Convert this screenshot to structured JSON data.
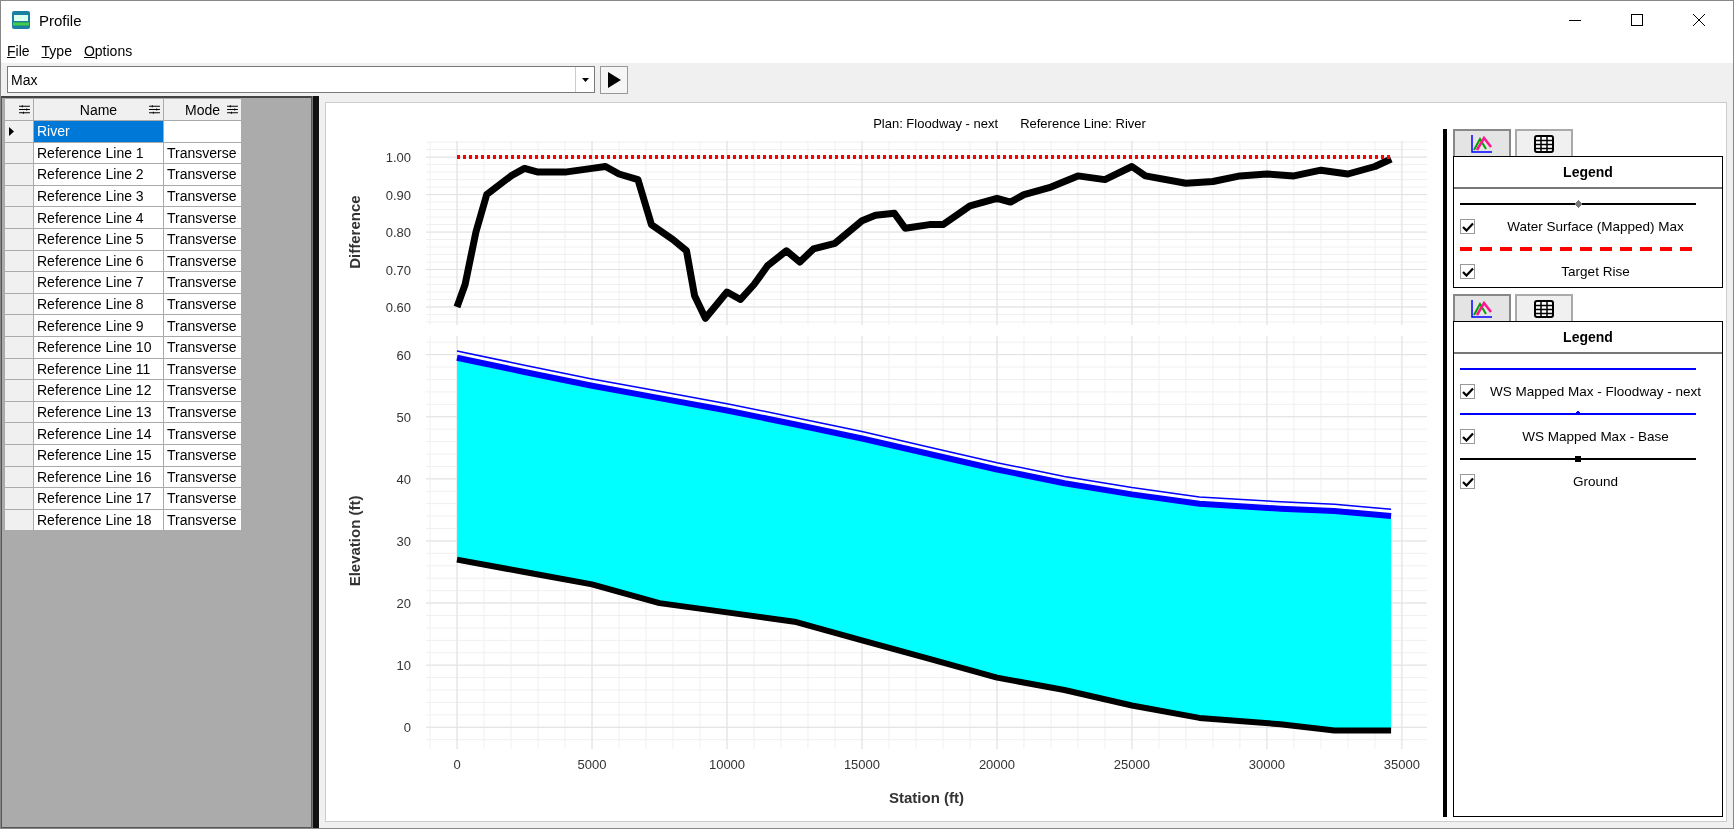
{
  "window": {
    "title": "Profile"
  },
  "menu": [
    "File",
    "Type",
    "Options"
  ],
  "profile_selector": {
    "value": "Max"
  },
  "table": {
    "columns": [
      "Name",
      "Mode"
    ],
    "rows": [
      {
        "name": "River",
        "selected": true
      },
      {
        "name": "Reference Line 1",
        "mode": "Transverse",
        "selected": false
      },
      {
        "name": "Reference Line 2",
        "mode": "Transverse",
        "selected": false
      },
      {
        "name": "Reference Line 3",
        "mode": "Transverse",
        "selected": false
      },
      {
        "name": "Reference Line 4",
        "mode": "Transverse",
        "selected": false
      },
      {
        "name": "Reference Line 5",
        "mode": "Transverse",
        "selected": false
      },
      {
        "name": "Reference Line 6",
        "mode": "Transverse",
        "selected": false
      },
      {
        "name": "Reference Line 7",
        "mode": "Transverse",
        "selected": false
      },
      {
        "name": "Reference Line 8",
        "mode": "Transverse",
        "selected": false
      },
      {
        "name": "Reference Line 9",
        "mode": "Transverse",
        "selected": false
      },
      {
        "name": "Reference Line 10",
        "mode": "Transverse",
        "selected": false
      },
      {
        "name": "Reference Line 11",
        "mode": "Transverse",
        "selected": false
      },
      {
        "name": "Reference Line 12",
        "mode": "Transverse",
        "selected": false
      },
      {
        "name": "Reference Line 13",
        "mode": "Transverse",
        "selected": false
      },
      {
        "name": "Reference Line 14",
        "mode": "Transverse",
        "selected": false
      },
      {
        "name": "Reference Line 15",
        "mode": "Transverse",
        "selected": false
      },
      {
        "name": "Reference Line 16",
        "mode": "Transverse",
        "selected": false
      },
      {
        "name": "Reference Line 17",
        "mode": "Transverse",
        "selected": false
      },
      {
        "name": "Reference Line 18",
        "mode": "Transverse",
        "selected": false
      }
    ]
  },
  "plot": {
    "title_parts": [
      "Plan: Floodway - next",
      "Reference Line: River"
    ],
    "difference_chart": {
      "chart_data": {
        "type": "line",
        "grid": true,
        "ylabel": "Difference",
        "x": [
          0,
          300,
          700,
          1100,
          2000,
          2500,
          3000,
          4000,
          5000,
          5500,
          6000,
          6700,
          7200,
          8000,
          8500,
          8800,
          9200,
          10000,
          10500,
          11000,
          11500,
          12200,
          12700,
          13200,
          14000,
          15000,
          15500,
          16200,
          16600,
          17500,
          18000,
          19000,
          20000,
          20500,
          21000,
          22000,
          23000,
          24000,
          25000,
          25500,
          27000,
          28000,
          29000,
          30000,
          31000,
          32000,
          33000,
          34000,
          34600
        ],
        "xlim": [
          -1150,
          35930
        ],
        "ylim": [
          0.552,
          1.043
        ],
        "yticks": [
          {
            "value": 0.6,
            "label": "0.60"
          },
          {
            "value": 0.7,
            "label": "0.70"
          },
          {
            "value": 0.8,
            "label": "0.80"
          },
          {
            "value": 0.9,
            "label": "0.90"
          },
          {
            "value": 1.0,
            "label": "1.00"
          }
        ],
        "series": [
          {
            "name": "Water Surface (Mapped) Max",
            "color": "#000000",
            "line_style": "solid",
            "values": [
              0.6,
              0.66,
              0.8,
              0.9,
              0.95,
              0.97,
              0.96,
              0.96,
              0.97,
              0.975,
              0.955,
              0.94,
              0.82,
              0.78,
              0.75,
              0.63,
              0.57,
              0.64,
              0.62,
              0.66,
              0.71,
              0.75,
              0.72,
              0.755,
              0.77,
              0.83,
              0.845,
              0.85,
              0.81,
              0.82,
              0.82,
              0.87,
              0.89,
              0.88,
              0.9,
              0.92,
              0.95,
              0.94,
              0.975,
              0.95,
              0.93,
              0.935,
              0.95,
              0.955,
              0.95,
              0.965,
              0.955,
              0.975,
              0.995
            ]
          },
          {
            "name": "Target Rise",
            "color": "#ff0000",
            "line_style": "dotted",
            "values": [
              1,
              1,
              1,
              1,
              1,
              1,
              1,
              1,
              1,
              1,
              1,
              1,
              1,
              1,
              1,
              1,
              1,
              1,
              1,
              1,
              1,
              1,
              1,
              1,
              1,
              1,
              1,
              1,
              1,
              1,
              1,
              1,
              1,
              1,
              1,
              1,
              1,
              1,
              1,
              1,
              1,
              1,
              1,
              1,
              1,
              1,
              1,
              1,
              1
            ]
          }
        ]
      }
    },
    "elevation_chart": {
      "chart_data": {
        "type": "line",
        "grid": true,
        "xlabel": "Station (ft)",
        "ylabel": "Elevation (ft)",
        "x": [
          0,
          2500,
          5000,
          7500,
          10000,
          12500,
          15000,
          17500,
          20000,
          22500,
          25000,
          27500,
          30500,
          32500,
          34600
        ],
        "xlim": [
          -1150,
          35930
        ],
        "ylim": [
          -3.5,
          63
        ],
        "xticks": [
          0,
          5000,
          10000,
          15000,
          20000,
          25000,
          30000,
          35000
        ],
        "yticks": [
          0,
          10,
          20,
          30,
          40,
          50,
          60
        ],
        "series": [
          {
            "name": "WS Mapped Max - Floodway - next",
            "type": "area",
            "color": "#0000ff",
            "line_style": "solid",
            "values": [
              59.5,
              57.2,
              55,
              53,
              51,
              48.8,
              46.5,
              44,
              41.5,
              39.3,
              37.5,
              36,
              35.2,
              34.8,
              34
            ]
          },
          {
            "name": "WS Mapped Max - Base",
            "type": "line",
            "color": "#0000ff",
            "line_style": "solid",
            "values": [
              60.6,
              58.3,
              56.1,
              54.1,
              52.1,
              49.9,
              47.6,
              45.1,
              42.6,
              40.4,
              38.6,
              37.1,
              36.3,
              35.9,
              35.1
            ]
          },
          {
            "name": "Ground",
            "type": "line",
            "color": "#000000",
            "line_style": "solid",
            "values": [
              27,
              25,
              23,
              20,
              18.5,
              17,
              14,
              11,
              8,
              6,
              3.5,
              1.5,
              0.5,
              -0.5,
              -0.5
            ]
          }
        ]
      }
    }
  },
  "legends": [
    {
      "tabs": [
        {
          "kind": "chart",
          "selected": true
        },
        {
          "kind": "table",
          "selected": false
        }
      ],
      "heading": "Legend",
      "items": [
        {
          "kind": "line-diamond",
          "checked": true
        },
        {
          "kind": "dashed",
          "checked": true
        }
      ]
    },
    {
      "tabs": [
        {
          "kind": "chart",
          "selected": true
        },
        {
          "kind": "table",
          "selected": false
        }
      ],
      "heading": "Legend",
      "items": [
        {
          "kind": "line",
          "checked": true
        },
        {
          "kind": "line-triangle",
          "checked": true
        },
        {
          "kind": "line-square",
          "checked": true
        }
      ]
    }
  ]
}
